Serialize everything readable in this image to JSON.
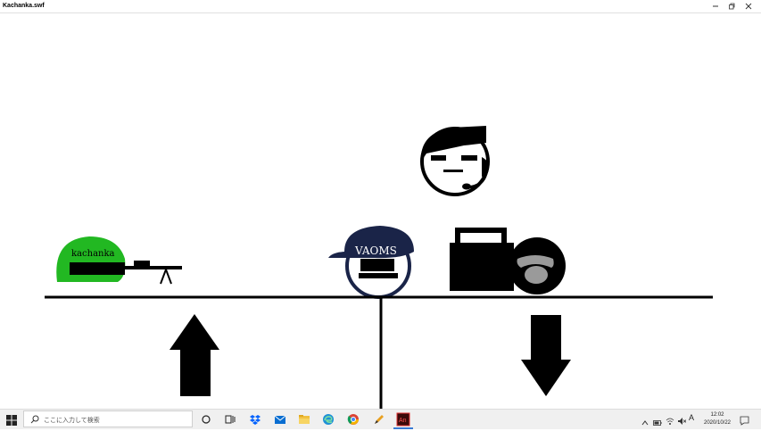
{
  "window": {
    "title": "Kachanka.swf"
  },
  "stage": {
    "left_character_text": "kachanka",
    "center_character_text": "VAOMS"
  },
  "taskbar": {
    "search_placeholder": "ここに入力して検索",
    "clock_time": "12:02",
    "clock_date": "2020/10/22",
    "ime_indicator": "A"
  },
  "icons": {
    "window": [
      "minimize-icon",
      "restore-icon",
      "close-icon"
    ],
    "taskbar": [
      "windows-start-icon",
      "search-icon",
      "cortana-icon",
      "task-view-icon",
      "dropbox-icon",
      "mail-icon",
      "file-explorer-icon",
      "edge-icon",
      "chrome-icon",
      "pen-app-icon",
      "animate-app-icon"
    ],
    "tray": [
      "chevron-up-icon",
      "battery-icon",
      "network-icon",
      "volume-muted-icon",
      "notification-icon"
    ]
  },
  "colors": {
    "green_blob": "#22b822",
    "navy_cap": "#1a2448",
    "ink": "#000000",
    "taskbar": "#f0f0f0"
  }
}
